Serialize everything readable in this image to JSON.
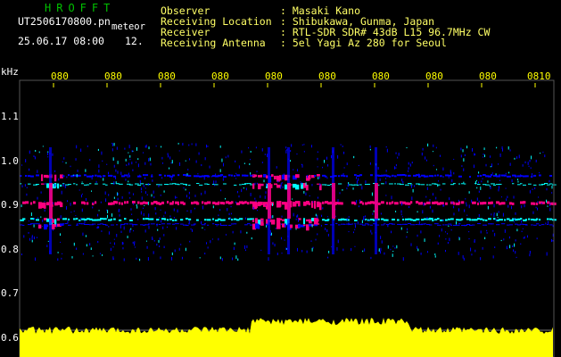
{
  "header": {
    "program_title": "HROFFT",
    "filename": "UT2506170800.pn",
    "mode": "meteor",
    "datetime": "25.06.17 08:00",
    "count": "12."
  },
  "station": {
    "labels": [
      "Observer",
      "Receiving Location",
      "Receiver",
      "Receiving Antenna"
    ],
    "values": [
      ": Masaki Kano",
      ": Shibukawa, Gunma, Japan",
      ": RTL-SDR SDR# 43dB L15 96.7MHz CW",
      ": 5el Yagi Az 280 for Seoul"
    ]
  },
  "time_axis": {
    "labels": [
      "080",
      "080",
      "080",
      "080",
      "080",
      "080",
      "080",
      "080",
      "080",
      "0810"
    ]
  },
  "freq_axis": {
    "unit": "kHz",
    "labels": [
      "1.1",
      "1.0",
      "0.9",
      "0.8",
      "0.7",
      "0.6"
    ]
  },
  "colors": {
    "background": "#000000",
    "signal_low": "#0000ff",
    "signal_mid": "#00ffff",
    "signal_high": "#ff0080",
    "profile": "#ffff00",
    "tick": "#ffff00",
    "grid": "#444444"
  }
}
